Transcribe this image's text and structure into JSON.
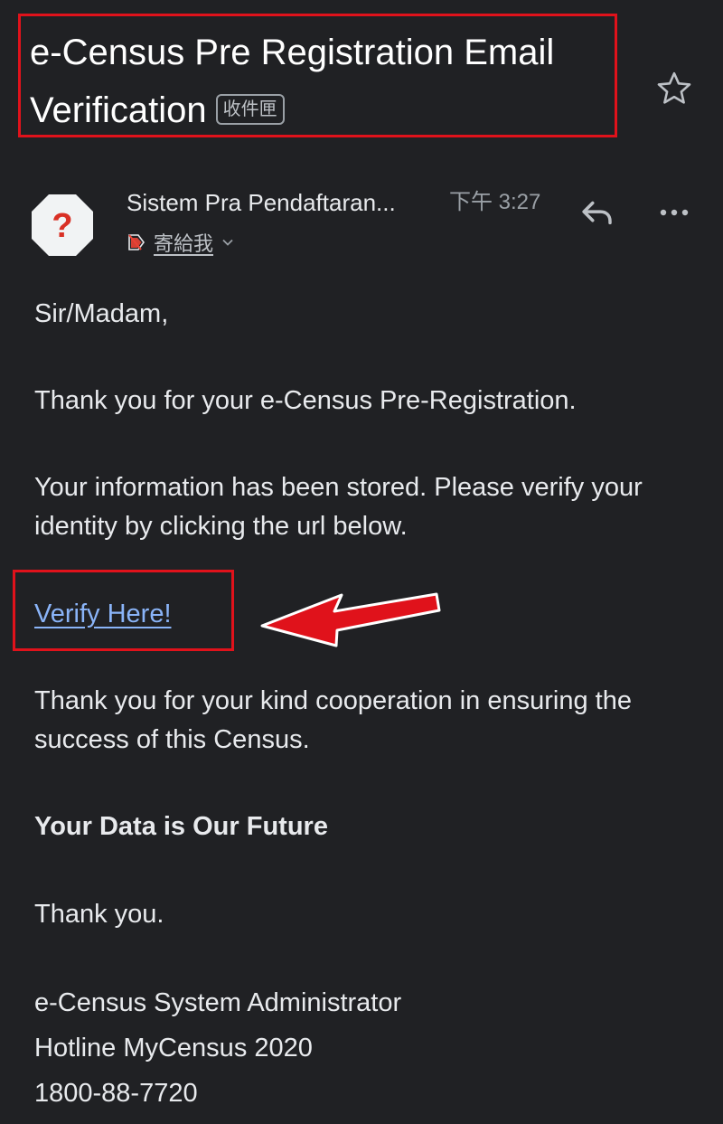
{
  "email": {
    "subject": "e-Census Pre Registration Email Verification",
    "label": "收件匣",
    "sender": "Sistem Pra Pendaftaran...",
    "time": "下午 3:27",
    "recipient": "寄給我",
    "avatar_glyph": "?"
  },
  "icons": {
    "star": "star-outline-icon",
    "reply": "reply-icon",
    "more": "more-horizontal-icon",
    "avatar": "unknown-sender-icon",
    "tag": "important-tag-icon",
    "chevron": "chevron-down-icon"
  },
  "body": {
    "greeting": "Sir/Madam,",
    "thanks_registration": "Thank you for your e-Census Pre-Registration.",
    "info_stored": "Your information has been stored. Please verify your identity by clicking the url below.",
    "verify_link": "Verify Here!",
    "thanks_cooperation": "Thank you for your kind cooperation in ensuring the success of this Census.",
    "motto": "Your Data is Our Future",
    "closing": "Thank you."
  },
  "signature": {
    "name": "e-Census System Administrator",
    "hotline": "Hotline MyCensus 2020",
    "phone": "1800-88-7720"
  },
  "colors": {
    "background": "#202124",
    "text": "#e8eaed",
    "link": "#8ab4f8",
    "highlight": "#e0121b"
  }
}
